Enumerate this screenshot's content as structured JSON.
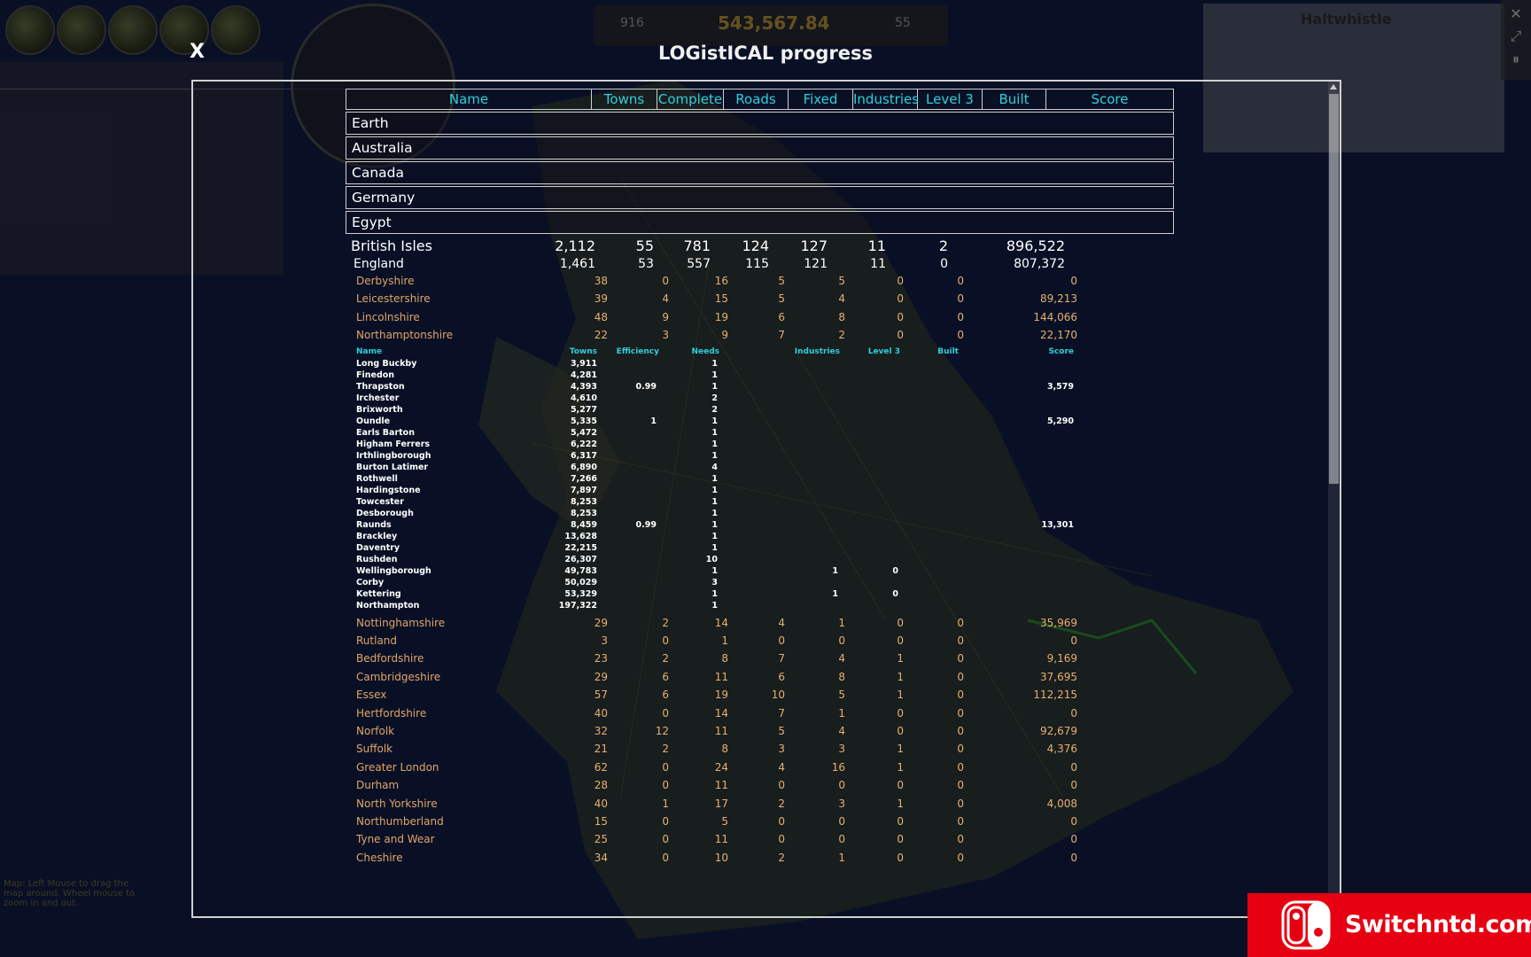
{
  "hud": {
    "city_panel_title": "Haltwhistle",
    "map_hint": "Map: Left Mouse to drag the map around. Wheel mouse to zoom in and out.",
    "money": "543,567.84",
    "counter_left": "916",
    "counter_right": "55",
    "right_side_buttons": [
      "✕",
      "⤢",
      "⏸"
    ]
  },
  "dialog": {
    "close_label": "X",
    "title": "LOGistICAL progress"
  },
  "columns": [
    "Name",
    "Towns",
    "Complete",
    "Roads",
    "Fixed",
    "Industries",
    "Level 3",
    "Built",
    "Score"
  ],
  "regions": [
    "Earth",
    "Australia",
    "Canada",
    "Germany",
    "Egypt"
  ],
  "british_isles": {
    "name": "British Isles",
    "values": [
      "2,112",
      "55",
      "781",
      "124",
      "127",
      "11",
      "2",
      "896,522"
    ]
  },
  "england": {
    "name": "England",
    "values": [
      "1,461",
      "53",
      "557",
      "115",
      "121",
      "11",
      "0",
      "807,372"
    ]
  },
  "counties_before": [
    {
      "name": "Derbyshire",
      "values": [
        "38",
        "0",
        "16",
        "5",
        "5",
        "0",
        "0",
        "0"
      ]
    },
    {
      "name": "Leicestershire",
      "values": [
        "39",
        "4",
        "15",
        "5",
        "4",
        "0",
        "0",
        "89,213"
      ]
    },
    {
      "name": "Lincolnshire",
      "values": [
        "48",
        "9",
        "19",
        "6",
        "8",
        "0",
        "0",
        "144,066"
      ]
    },
    {
      "name": "Northamptonshire",
      "values": [
        "22",
        "3",
        "9",
        "7",
        "2",
        "0",
        "0",
        "22,170"
      ]
    }
  ],
  "town_columns": [
    "Name",
    "Towns",
    "Efficiency",
    "Needs",
    "Industries",
    "Level 3",
    "Built",
    "Score"
  ],
  "towns": [
    {
      "name": "Long Buckby",
      "pop": "3,911",
      "eff": "",
      "needs": "1",
      "ind": "",
      "lvl": "",
      "score": ""
    },
    {
      "name": "Finedon",
      "pop": "4,281",
      "eff": "",
      "needs": "1",
      "ind": "",
      "lvl": "",
      "score": ""
    },
    {
      "name": "Thrapston",
      "pop": "4,393",
      "eff": "0.99",
      "needs": "1",
      "ind": "",
      "lvl": "",
      "score": "3,579"
    },
    {
      "name": "Irchester",
      "pop": "4,610",
      "eff": "",
      "needs": "2",
      "ind": "",
      "lvl": "",
      "score": ""
    },
    {
      "name": "Brixworth",
      "pop": "5,277",
      "eff": "",
      "needs": "2",
      "ind": "",
      "lvl": "",
      "score": ""
    },
    {
      "name": "Oundle",
      "pop": "5,335",
      "eff": "1",
      "needs": "1",
      "ind": "",
      "lvl": "",
      "score": "5,290"
    },
    {
      "name": "Earls Barton",
      "pop": "5,472",
      "eff": "",
      "needs": "1",
      "ind": "",
      "lvl": "",
      "score": ""
    },
    {
      "name": "Higham Ferrers",
      "pop": "6,222",
      "eff": "",
      "needs": "1",
      "ind": "",
      "lvl": "",
      "score": ""
    },
    {
      "name": "Irthlingborough",
      "pop": "6,317",
      "eff": "",
      "needs": "1",
      "ind": "",
      "lvl": "",
      "score": ""
    },
    {
      "name": "Burton Latimer",
      "pop": "6,890",
      "eff": "",
      "needs": "4",
      "ind": "",
      "lvl": "",
      "score": ""
    },
    {
      "name": "Rothwell",
      "pop": "7,266",
      "eff": "",
      "needs": "1",
      "ind": "",
      "lvl": "",
      "score": ""
    },
    {
      "name": "Hardingstone",
      "pop": "7,897",
      "eff": "",
      "needs": "1",
      "ind": "",
      "lvl": "",
      "score": ""
    },
    {
      "name": "Towcester",
      "pop": "8,253",
      "eff": "",
      "needs": "1",
      "ind": "",
      "lvl": "",
      "score": ""
    },
    {
      "name": "Desborough",
      "pop": "8,253",
      "eff": "",
      "needs": "1",
      "ind": "",
      "lvl": "",
      "score": ""
    },
    {
      "name": "Raunds",
      "pop": "8,459",
      "eff": "0.99",
      "needs": "1",
      "ind": "",
      "lvl": "",
      "score": "13,301"
    },
    {
      "name": "Brackley",
      "pop": "13,628",
      "eff": "",
      "needs": "1",
      "ind": "",
      "lvl": "",
      "score": ""
    },
    {
      "name": "Daventry",
      "pop": "22,215",
      "eff": "",
      "needs": "1",
      "ind": "",
      "lvl": "",
      "score": ""
    },
    {
      "name": "Rushden",
      "pop": "26,307",
      "eff": "",
      "needs": "10",
      "ind": "",
      "lvl": "",
      "score": ""
    },
    {
      "name": "Wellingborough",
      "pop": "49,783",
      "eff": "",
      "needs": "1",
      "ind": "1",
      "lvl": "0",
      "score": ""
    },
    {
      "name": "Corby",
      "pop": "50,029",
      "eff": "",
      "needs": "3",
      "ind": "",
      "lvl": "",
      "score": ""
    },
    {
      "name": "Kettering",
      "pop": "53,329",
      "eff": "",
      "needs": "1",
      "ind": "1",
      "lvl": "0",
      "score": ""
    },
    {
      "name": "Northampton",
      "pop": "197,322",
      "eff": "",
      "needs": "1",
      "ind": "",
      "lvl": "",
      "score": ""
    }
  ],
  "counties_after": [
    {
      "name": "Nottinghamshire",
      "values": [
        "29",
        "2",
        "14",
        "4",
        "1",
        "0",
        "0",
        "35,969"
      ]
    },
    {
      "name": "Rutland",
      "values": [
        "3",
        "0",
        "1",
        "0",
        "0",
        "0",
        "0",
        "0"
      ]
    },
    {
      "name": "Bedfordshire",
      "values": [
        "23",
        "2",
        "8",
        "7",
        "4",
        "1",
        "0",
        "9,169"
      ]
    },
    {
      "name": "Cambridgeshire",
      "values": [
        "29",
        "6",
        "11",
        "6",
        "8",
        "1",
        "0",
        "37,695"
      ]
    },
    {
      "name": "Essex",
      "values": [
        "57",
        "6",
        "19",
        "10",
        "5",
        "1",
        "0",
        "112,215"
      ]
    },
    {
      "name": "Hertfordshire",
      "values": [
        "40",
        "0",
        "14",
        "7",
        "1",
        "0",
        "0",
        "0"
      ]
    },
    {
      "name": "Norfolk",
      "values": [
        "32",
        "12",
        "11",
        "5",
        "4",
        "0",
        "0",
        "92,679"
      ]
    },
    {
      "name": "Suffolk",
      "values": [
        "21",
        "2",
        "8",
        "3",
        "3",
        "1",
        "0",
        "4,376"
      ]
    },
    {
      "name": "Greater London",
      "values": [
        "62",
        "0",
        "24",
        "4",
        "16",
        "1",
        "0",
        "0"
      ]
    },
    {
      "name": "Durham",
      "values": [
        "28",
        "0",
        "11",
        "0",
        "0",
        "0",
        "0",
        "0"
      ]
    },
    {
      "name": "North Yorkshire",
      "values": [
        "40",
        "1",
        "17",
        "2",
        "3",
        "1",
        "0",
        "4,008"
      ]
    },
    {
      "name": "Northumberland",
      "values": [
        "15",
        "0",
        "5",
        "0",
        "0",
        "0",
        "0",
        "0"
      ]
    },
    {
      "name": "Tyne and Wear",
      "values": [
        "25",
        "0",
        "11",
        "0",
        "0",
        "0",
        "0",
        "0"
      ]
    },
    {
      "name": "Cheshire",
      "values": [
        "34",
        "0",
        "10",
        "2",
        "1",
        "0",
        "0",
        "0"
      ]
    }
  ],
  "logo": {
    "text": "Switchntd.com",
    "brand_color": "#e60012"
  },
  "colors": {
    "header_cyan": "#2fd0d9",
    "county_orange": "#e0a56a",
    "map_sea": "#0d1530"
  }
}
